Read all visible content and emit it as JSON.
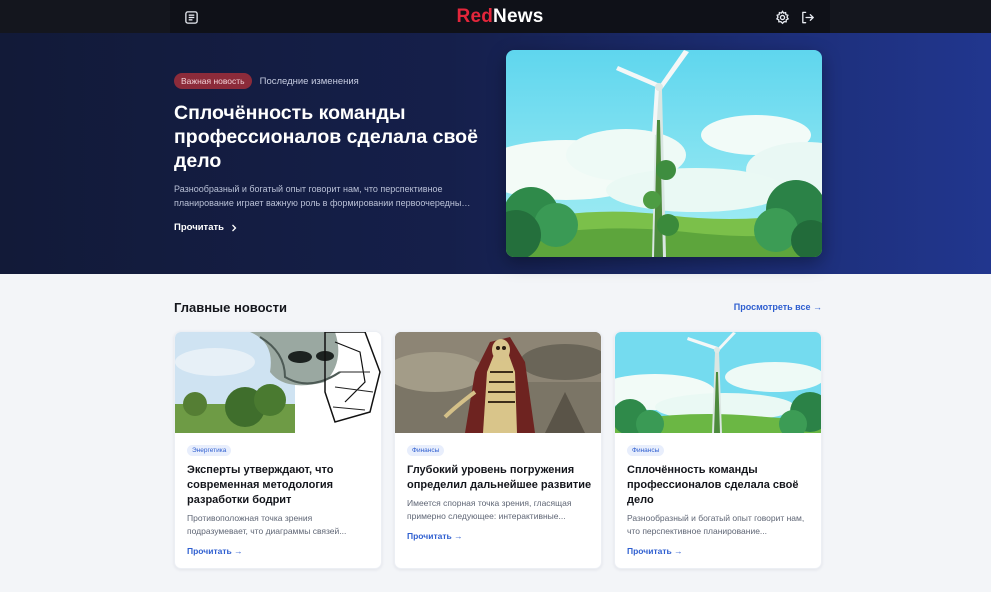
{
  "header": {
    "logo_red": "Red",
    "logo_white": "News",
    "icons": [
      "newspaper-icon",
      "gear-icon",
      "logout-icon"
    ]
  },
  "hero": {
    "badge": "Важная новость",
    "subtitle": "Последние изменения",
    "title": "Сплочённость команды профессионалов сделала своё дело",
    "description": "Разнообразный и богатый опыт говорит нам, что перспективное планирование играет важную роль в формировании первоочередных требований",
    "read_label": "Прочитать"
  },
  "section": {
    "title": "Главные новости",
    "view_all": "Просмотреть все →"
  },
  "cards": [
    {
      "tag": "Энергетика",
      "title": "Эксперты утверждают, что современная методология разработки бодрит",
      "description": "Противоположная точка зрения подразумевает, что диаграммы связей...",
      "read_label": "Прочитать →"
    },
    {
      "tag": "Финансы",
      "title": "Глубокий уровень погружения определил дальнейшее развитие",
      "description": "Имеется спорная точка зрения, гласящая примерно следующее: интерактивные...",
      "read_label": "Прочитать →"
    },
    {
      "tag": "Финансы",
      "title": "Сплочённость команды профессионалов сделала своё дело",
      "description": "Разнообразный и богатый опыт говорит нам, что перспективное планирование...",
      "read_label": "Прочитать →"
    }
  ],
  "colors": {
    "brand_red": "#e3263b",
    "accent_blue": "#2f5fd0",
    "hero_dark": "#121a38"
  }
}
